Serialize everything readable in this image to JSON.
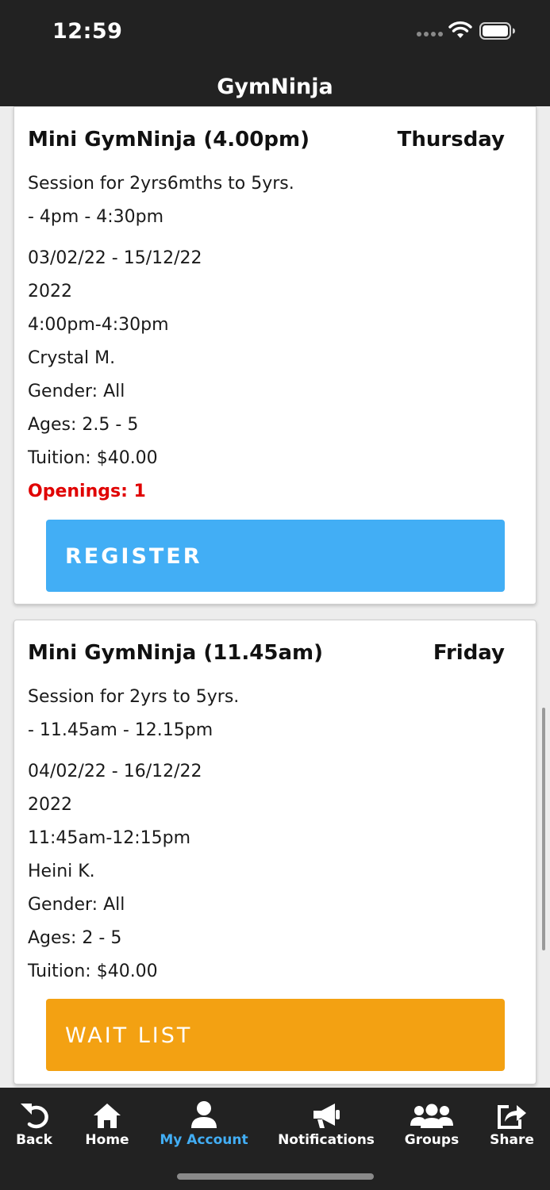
{
  "status_bar": {
    "time": "12:59"
  },
  "header": {
    "title": "GymNinja"
  },
  "classes": [
    {
      "name": "Mini GymNinja (4.00pm)",
      "day": "Thursday",
      "description": "Session for 2yrs6mths to 5yrs.",
      "time_note": "- 4pm - 4:30pm",
      "dates": "03/02/22 - 15/12/22",
      "year": "2022",
      "time": "4:00pm-4:30pm",
      "instructor": "Crystal M.",
      "gender": "Gender: All",
      "ages": "Ages: 2.5 - 5",
      "tuition": "Tuition: $40.00",
      "openings": "Openings: 1",
      "action_label": "REGISTER"
    },
    {
      "name": "Mini GymNinja (11.45am)",
      "day": "Friday",
      "description": "Session for 2yrs to 5yrs.",
      "time_note": "- 11.45am - 12.15pm",
      "dates": "04/02/22 - 16/12/22",
      "year": "2022",
      "time": "11:45am-12:15pm",
      "instructor": "Heini K.",
      "gender": "Gender: All",
      "ages": "Ages: 2 - 5",
      "tuition": "Tuition: $40.00",
      "action_label": "WAIT LIST"
    }
  ],
  "tab_bar": {
    "items": [
      {
        "label": "Back",
        "icon": "back-arrow-icon"
      },
      {
        "label": "Home",
        "icon": "home-icon"
      },
      {
        "label": "My Account",
        "icon": "user-icon",
        "active": true
      },
      {
        "label": "Notifications",
        "icon": "megaphone-icon"
      },
      {
        "label": "Groups",
        "icon": "group-icon"
      },
      {
        "label": "Share",
        "icon": "share-icon"
      }
    ]
  },
  "colors": {
    "bar_background": "#222222",
    "register_button": "#42aef5",
    "waitlist_button": "#f3a112",
    "openings_text": "#e00000",
    "active_tab": "#42aef5"
  }
}
